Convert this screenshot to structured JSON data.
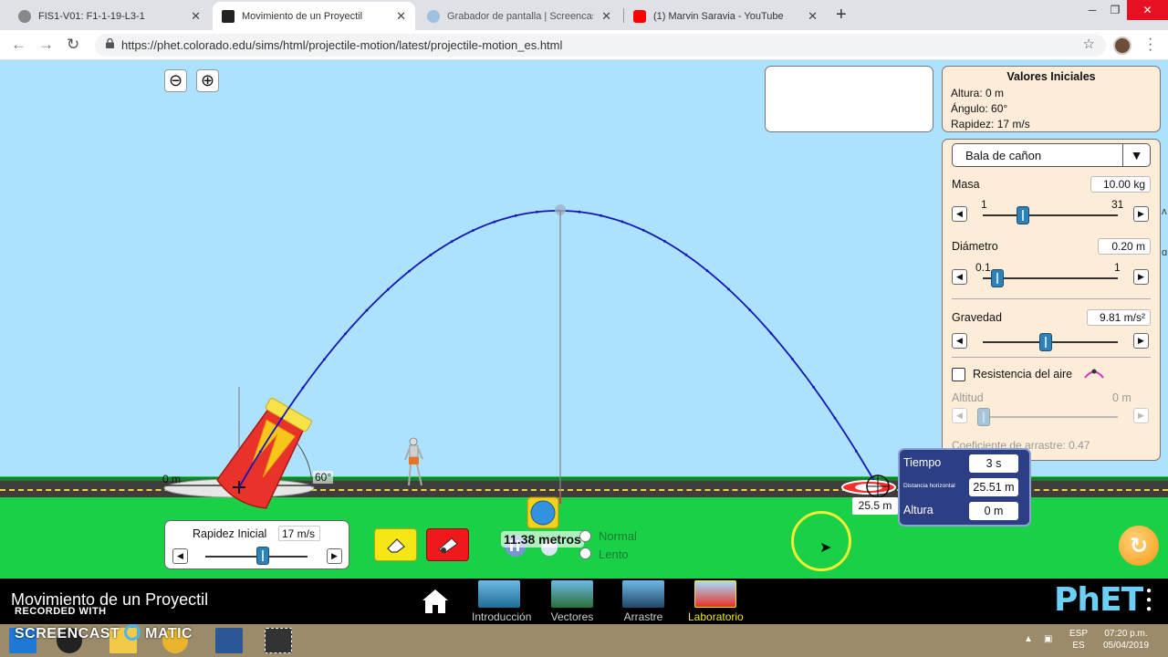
{
  "browser": {
    "tabs": [
      {
        "title": "FIS1-V01: F1-1-19-L3-1",
        "active": false,
        "favicon_color": "#888888"
      },
      {
        "title": "Movimiento de un Proyectil",
        "active": true,
        "favicon_color": "#222222"
      },
      {
        "title": "Grabador de pantalla | Screencas",
        "active": false,
        "favicon_color": "#a0c0e0"
      },
      {
        "title": "(1) Marvin Saravia - YouTube",
        "active": false,
        "favicon_color": "#ff0000"
      }
    ],
    "url": "https://phet.colorado.edu/sims/html/projectile-motion/latest/projectile-motion_es.html"
  },
  "initial_values": {
    "title": "Valores Iniciales",
    "rows": [
      "Altura: 0 m",
      "Ángulo: 60°",
      "Rapidez: 17 m/s"
    ]
  },
  "controls": {
    "projectile_type": "Bala de cañon",
    "mass": {
      "label": "Masa",
      "value_text": "10.00 kg",
      "min_label": "1",
      "max_label": "31",
      "value": 10,
      "min": 1,
      "max": 31
    },
    "diameter": {
      "label": "Diámetro",
      "value_text": "0.20 m",
      "min_label": "0.1",
      "max_label": "1",
      "value": 0.2,
      "min": 0.1,
      "max": 1
    },
    "gravity": {
      "label": "Gravedad",
      "value_text": "9.81 m/s²",
      "value": 9.81,
      "min": 1,
      "max": 20
    },
    "air_resistance_label": "Resistencia del aire",
    "altitude": {
      "label": "Altitud",
      "value_text": "0 m"
    },
    "drag_text": "Coeficiente de arrastre: 0.47"
  },
  "readout": {
    "time_label": "Tiempo",
    "time_value": "3 s",
    "distance_label": "Distancia horizontal",
    "distance_value": "25.51 m",
    "height_label": "Altura",
    "height_value": "0 m"
  },
  "scene": {
    "height_marker": "0 m",
    "angle_marker": "60°",
    "distance_marker": "25.5 m",
    "tape_reading": "11.38 metros"
  },
  "launch": {
    "label": "Rapidez Inicial",
    "value_text": "17 m/s",
    "value": 17,
    "min": 0,
    "max": 30
  },
  "playback": {
    "normal_label": "Normal",
    "slow_label": "Lento",
    "selected": "normal"
  },
  "navbar": {
    "sim_title": "Movimiento de un Proyectil",
    "screens": [
      {
        "label": "Introducción",
        "selected": false
      },
      {
        "label": "Vectores",
        "selected": false
      },
      {
        "label": "Arrastre",
        "selected": false
      },
      {
        "label": "Laboratorio",
        "selected": true
      }
    ],
    "logo": "PhET"
  },
  "watermark": {
    "line1": "RECORDED WITH",
    "line2": "SCREENCAST",
    "line3": "MATIC"
  },
  "taskbar": {
    "lang_top": "ESP",
    "lang_bottom": "ES",
    "time": "07:20 p.m.",
    "date": "05/04/2019"
  },
  "colors": {
    "sky": "#ade2ff",
    "grass": "#1ad047",
    "panel_bg": "#fcecd8",
    "trajectory": "#1515b8",
    "readout_bg": "#2c3e84",
    "cannon": "#e8322a"
  }
}
